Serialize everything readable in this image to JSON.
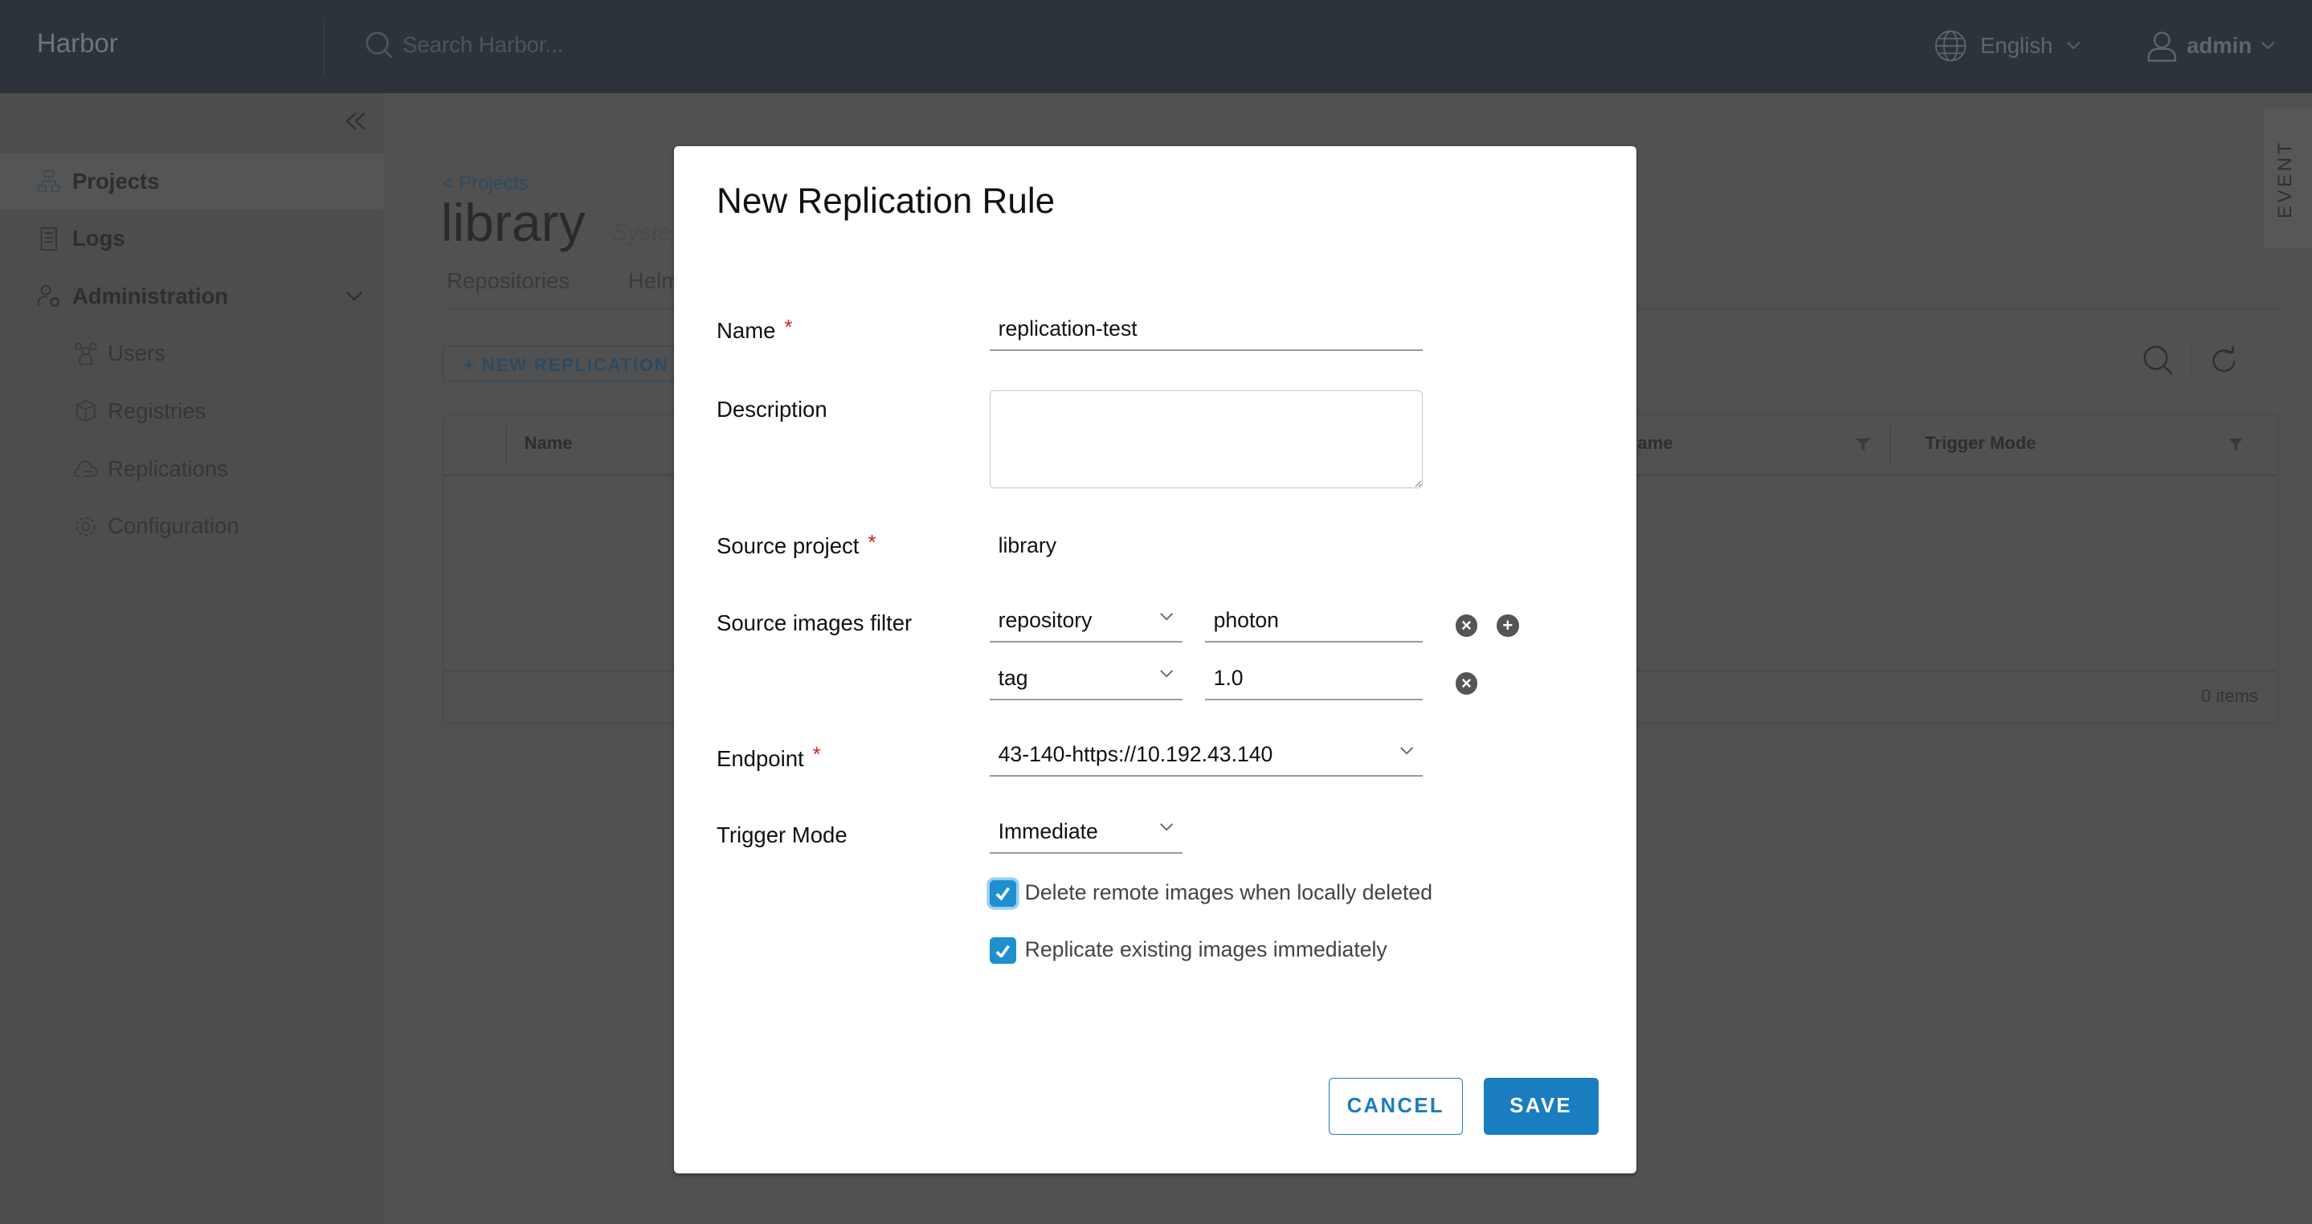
{
  "header": {
    "brand": "Harbor",
    "search_placeholder": "Search Harbor...",
    "language": "English",
    "user": "admin"
  },
  "sidebar": {
    "items": [
      {
        "label": "Projects",
        "icon": "projects-icon"
      },
      {
        "label": "Logs",
        "icon": "logs-icon"
      },
      {
        "label": "Administration",
        "icon": "administration-icon"
      },
      {
        "label": "Users",
        "icon": "users-icon"
      },
      {
        "label": "Registries",
        "icon": "registries-icon"
      },
      {
        "label": "Replications",
        "icon": "replications-icon"
      },
      {
        "label": "Configuration",
        "icon": "configuration-icon"
      }
    ]
  },
  "main": {
    "breadcrumb": "< Projects",
    "title": "library",
    "role_partial": "Syste",
    "tabs": [
      "Repositories",
      "Helm"
    ],
    "new_button": "+ NEW REPLICATION",
    "table": {
      "columns": [
        "Name",
        "ame",
        "Trigger Mode"
      ],
      "footer": "0 items"
    },
    "event_tab": "EVENT"
  },
  "modal": {
    "title": "New Replication Rule",
    "name_label": "Name",
    "name_value": "replication-test",
    "description_label": "Description",
    "description_value": "",
    "source_project_label": "Source project",
    "source_project_value": "library",
    "filter_label": "Source images filter",
    "filters": [
      {
        "type": "repository",
        "value": "photon"
      },
      {
        "type": "tag",
        "value": "1.0"
      }
    ],
    "endpoint_label": "Endpoint",
    "endpoint_value": "43-140-https://10.192.43.140",
    "trigger_label": "Trigger Mode",
    "trigger_value": "Immediate",
    "checkboxes": [
      {
        "label": "Delete remote images when locally deleted",
        "checked": true
      },
      {
        "label": "Replicate existing images immediately",
        "checked": true
      }
    ],
    "required_mark": "*",
    "cancel": "CANCEL",
    "save": "SAVE"
  },
  "colors": {
    "primary": "#1a7dc0",
    "checkbox": "#1e90d0",
    "required": "#d02020"
  }
}
